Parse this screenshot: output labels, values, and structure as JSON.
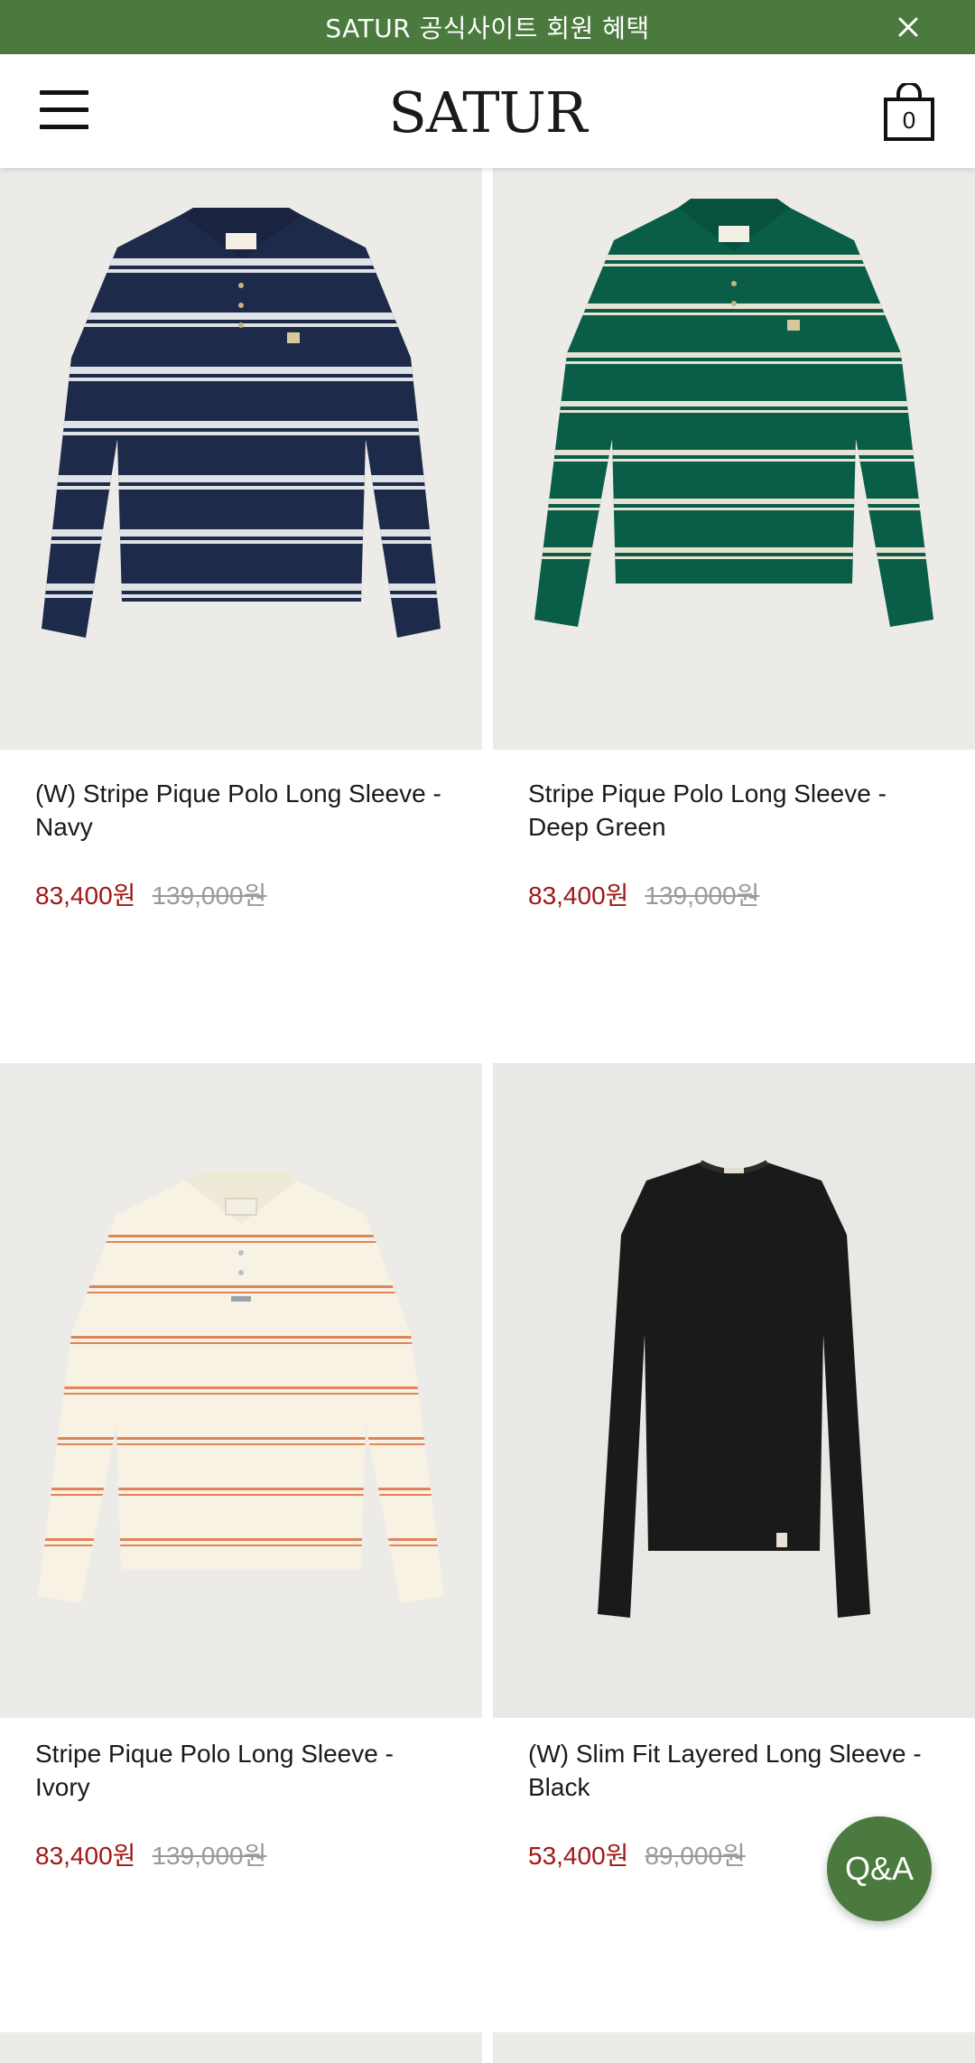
{
  "promo": {
    "text": "SATUR 공식사이트 회원 혜택"
  },
  "header": {
    "logo": "SATUR",
    "cart_count": "0"
  },
  "products": [
    {
      "name": "(W) Stripe Pique Polo Long Sleeve - Navy",
      "sale_price": "83,400원",
      "original_price": "139,000원",
      "shirt_color": "#1e2a4a",
      "stripe_color": "#dfe3e6"
    },
    {
      "name": "Stripe Pique Polo Long Sleeve - Deep Green",
      "sale_price": "83,400원",
      "original_price": "139,000원",
      "shirt_color": "#0a5e47",
      "stripe_color": "#e8e2d3"
    },
    {
      "name": "Stripe Pique Polo Long Sleeve - Ivory",
      "sale_price": "83,400원",
      "original_price": "139,000원",
      "shirt_color": "#f7f2e4",
      "stripe_color": "#e0845a"
    },
    {
      "name": "(W) Slim Fit Layered Long Sleeve - Black",
      "sale_price": "53,400원",
      "original_price": "89,000원",
      "shirt_color": "#1a1a1a",
      "stripe_color": ""
    }
  ],
  "qa_button": {
    "label": "Q&A"
  },
  "colors": {
    "brand_green": "#4a7a3d",
    "sale_red": "#a11616",
    "strike_gray": "#9a9a9a",
    "image_bg": "#ecebe7"
  }
}
